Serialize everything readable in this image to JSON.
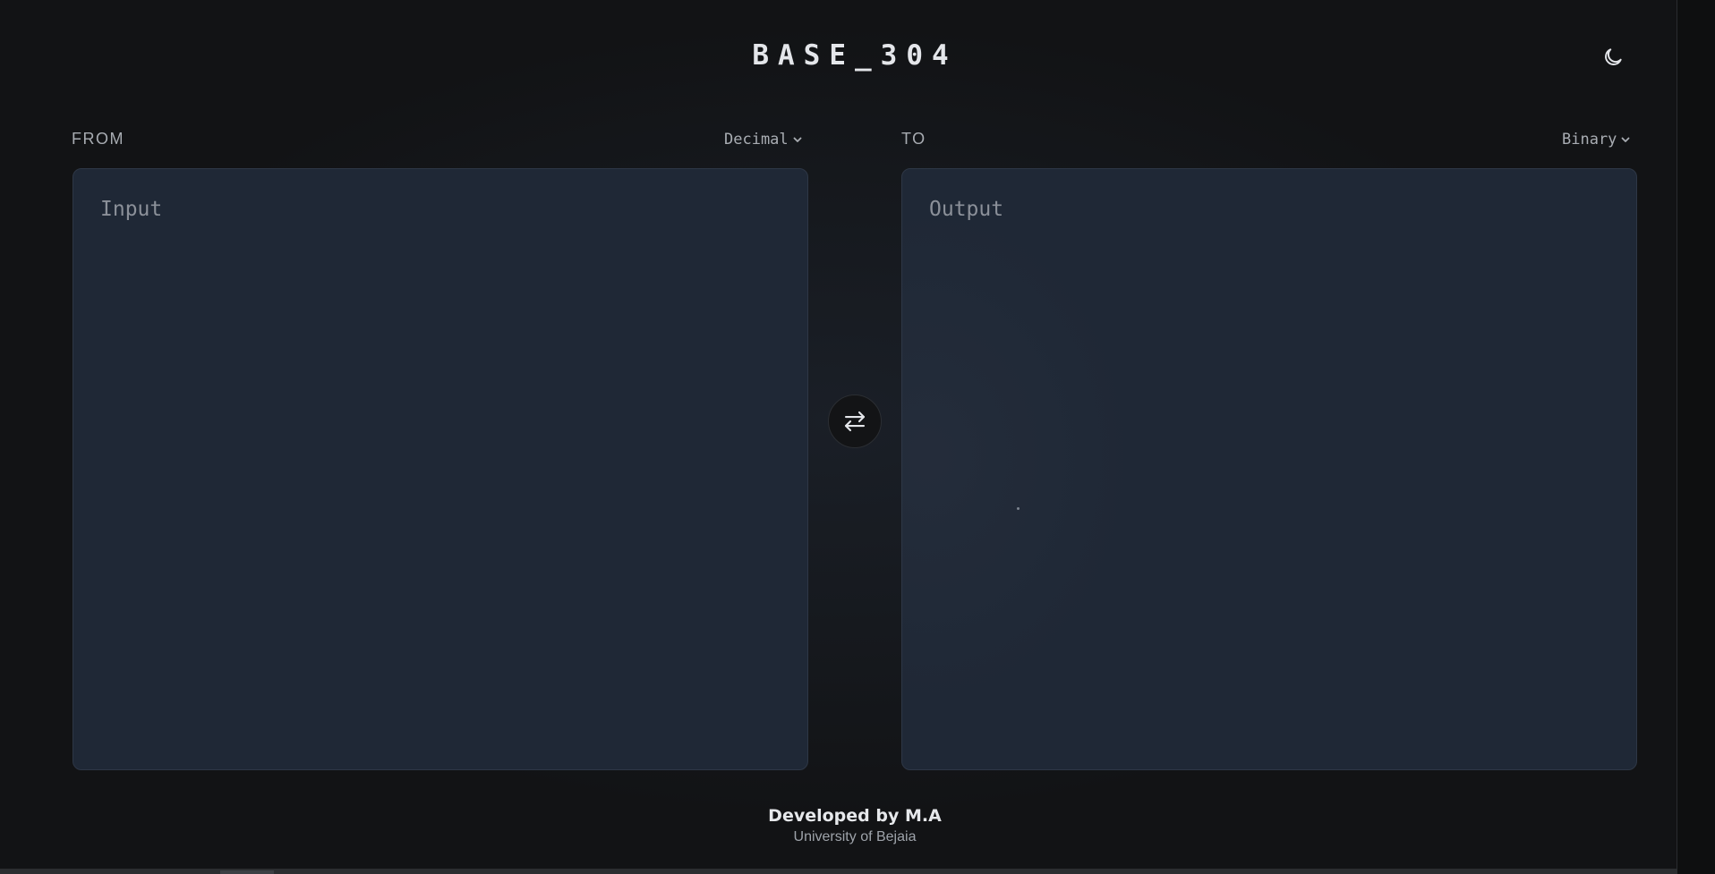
{
  "app": {
    "title": "BASE_304"
  },
  "header": {
    "theme_toggle_icon": "moon-icon"
  },
  "from": {
    "label": "FROM",
    "base": "Decimal",
    "placeholder": "Input",
    "value": ""
  },
  "to": {
    "label": "TO",
    "base": "Binary",
    "placeholder": "Output",
    "value": ""
  },
  "swap": {
    "icon": "swap-arrows-icon"
  },
  "footer": {
    "credit": "Developed by M.A",
    "organization": "University of Bejaia"
  },
  "colors": {
    "background": "#121315",
    "panel": "#1f2836",
    "text": "#e4e6ea",
    "muted": "#a8acb2"
  }
}
